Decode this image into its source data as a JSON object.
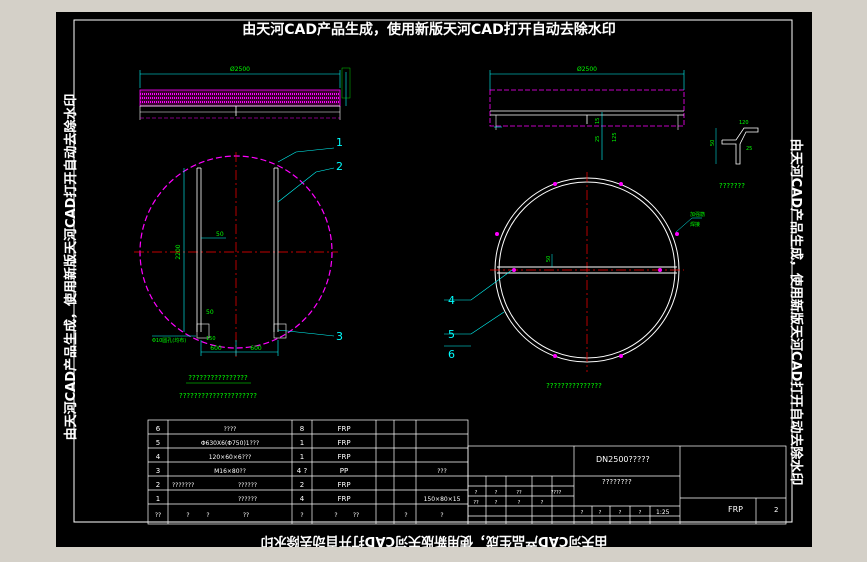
{
  "watermark": {
    "top": "由天河CAD产品生成，使用新版天河CAD打开自动去除水印",
    "bottom": "由天河CAD产品生成，使用新版天河CAD打开自动去除水印",
    "left": "由天河CAD产品生成，使用新版天河CAD打开自动去除水印",
    "right": "由天河CAD产品生成，使用新版天河CAD打开自动去除水印"
  },
  "callouts": [
    "1",
    "2",
    "3",
    "4",
    "5",
    "6"
  ],
  "dimensions": {
    "left_top_width": "Ø2500",
    "right_top_width": "Ø2500",
    "left_vert": "2200",
    "left_small_a": "50",
    "left_small_b": "50",
    "left_bottom_a": "600",
    "left_bottom_b": "600",
    "left_bottom_c": "150",
    "right_h1": "15",
    "right_h2": "25",
    "right_h3": "125",
    "right_circle_dim": "50",
    "detail_a": "50",
    "detail_b": "120",
    "detail_c": "25"
  },
  "notes": {
    "left_caption_1": "????????????????",
    "left_caption_2": "?????????????????????",
    "right_caption": "???????????????",
    "detail_caption": "???????",
    "left_side_note": "Φ10圆孔(均布)",
    "right_side_note": "加强筋\n焊接"
  },
  "bom": {
    "rows": [
      {
        "no": "6",
        "name": "????",
        "qty": "8",
        "mat": "FRP",
        "note": ""
      },
      {
        "no": "5",
        "name": "Φ630X6(Φ750)1???",
        "qty": "1",
        "mat": "FRP",
        "note": ""
      },
      {
        "no": "4",
        "name": "120×60×6???",
        "qty": "1",
        "mat": "FRP",
        "note": ""
      },
      {
        "no": "3",
        "name": "M16×80??",
        "qty": "4 ?",
        "mat": "PP",
        "note": "???"
      },
      {
        "no": "2",
        "name": "???????",
        "name2": "??????",
        "qty": "2",
        "mat": "FRP",
        "note": ""
      },
      {
        "no": "1",
        "name": "",
        "name2": "??????",
        "qty": "4",
        "mat": "FRP",
        "note": "150×80×15"
      }
    ],
    "header": [
      "??",
      "?",
      "?",
      "??",
      "?",
      "?",
      "??",
      "?",
      "?"
    ]
  },
  "title_block": {
    "title": "DN2500?????",
    "subtitle": "????????",
    "material": "FRP",
    "sheet": "2",
    "scale": "1:25",
    "cells": [
      "?",
      "?",
      "??",
      "????",
      "??",
      "?",
      "?",
      "?",
      "?",
      "?",
      "?",
      "?"
    ]
  }
}
